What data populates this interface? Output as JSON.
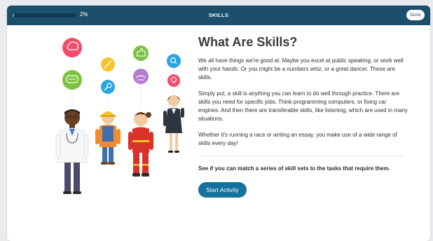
{
  "topbar": {
    "progress_percent": 2,
    "progress_label": "2%",
    "title": "SKILLS",
    "done_label": "Done"
  },
  "content": {
    "heading": "What Are Skills?",
    "paragraphs": [
      "We all have things we're good at. Maybe you excel at public speaking, or work well with your hands. Or you might be a numbers whiz, or a great dancer. These are skills.",
      "Simply put, a skill is anything you can learn to do well through practice. There are skills you need for specific jobs. Think programming computers, or fixing car engines. And then there are transferable skills, like listening, which are used in many situations.",
      "Whether it's running a race or writing an essay, you make use of a wide range of skills every day!"
    ],
    "prompt": "See if you can match a series of skill sets to the tasks that require them.",
    "start_label": "Start Activity"
  },
  "colors": {
    "topbar": "#1b4f6b",
    "progress": "#56c27a",
    "button": "#14729c",
    "bubble_pink": "#f04d6b",
    "bubble_green": "#7cc242",
    "bubble_yellow": "#f7c32e",
    "bubble_blue": "#2aa7df",
    "bubble_purple": "#b57bd0"
  },
  "illustration": {
    "icons": [
      "brain-icon",
      "speech-bubble-icon",
      "pencil-icon",
      "wrench-icon",
      "thumbs-up-icon",
      "hands-icon",
      "search-icon",
      "lightbulb-icon"
    ]
  }
}
